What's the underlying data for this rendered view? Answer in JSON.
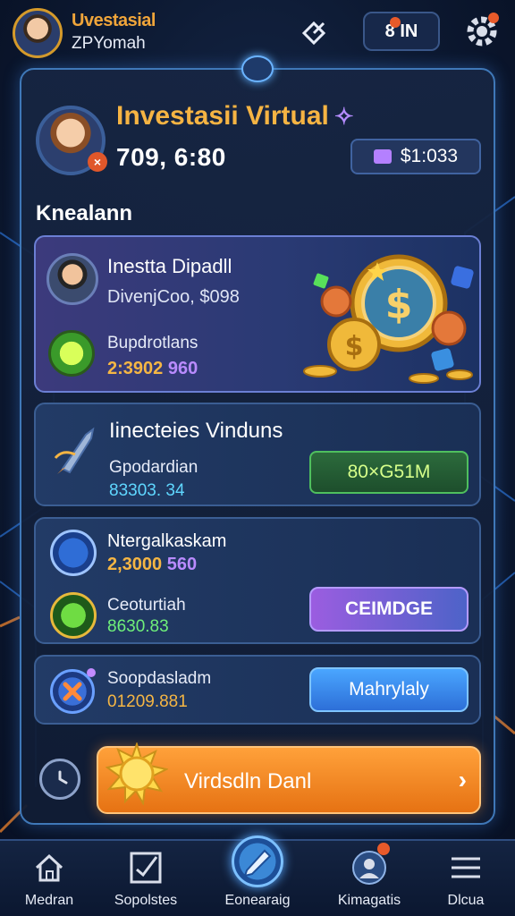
{
  "topbar": {
    "name": "Uvestasial",
    "subtitle": "ZPYomah",
    "pill_label": "8 IN",
    "share_icon": "share-icon",
    "settings_icon": "gear-icon"
  },
  "profile": {
    "title": "Investasii Virtual",
    "title_icon": "sparkle-icon",
    "value": "709, 6:80",
    "balance": "$1:033",
    "badge": "×"
  },
  "section": {
    "heading": "Knealann"
  },
  "card1": {
    "title": "Inestta Dipadll",
    "subtitle": "DivenjCoo, $098",
    "label": "Bupdrotlans",
    "value_a": "2:3902",
    "value_b": "960"
  },
  "card2": {
    "title": "Iinecteies Vinduns",
    "label": "Gpodardian",
    "value": "83303. 34",
    "button": "80×G51M"
  },
  "card3": {
    "title": "Ntergalkaskam",
    "value_a": "2,3000",
    "value_b": "560",
    "label": "Ceoturtiah",
    "value2": "8630.83",
    "button": "CEIMDGE"
  },
  "card4": {
    "label": "Soopdasladm",
    "value": "01209.881",
    "button": "Mahrylaly"
  },
  "cta": {
    "label": "Virdsdln Danl",
    "arrow": "›"
  },
  "nav": [
    {
      "label": "Medran",
      "icon": "home-icon"
    },
    {
      "label": "Sopolstes",
      "icon": "chart-icon"
    },
    {
      "label": "Eonearaig",
      "icon": "pencil-icon"
    },
    {
      "label": "Kimagatis",
      "icon": "user-icon"
    },
    {
      "label": "Dlcua",
      "icon": "menu-icon"
    }
  ],
  "colors": {
    "accent_orange": "#f6b443",
    "accent_purple": "#b98bff",
    "panel_border": "#3f78b8",
    "cta": "#ff9a33"
  }
}
